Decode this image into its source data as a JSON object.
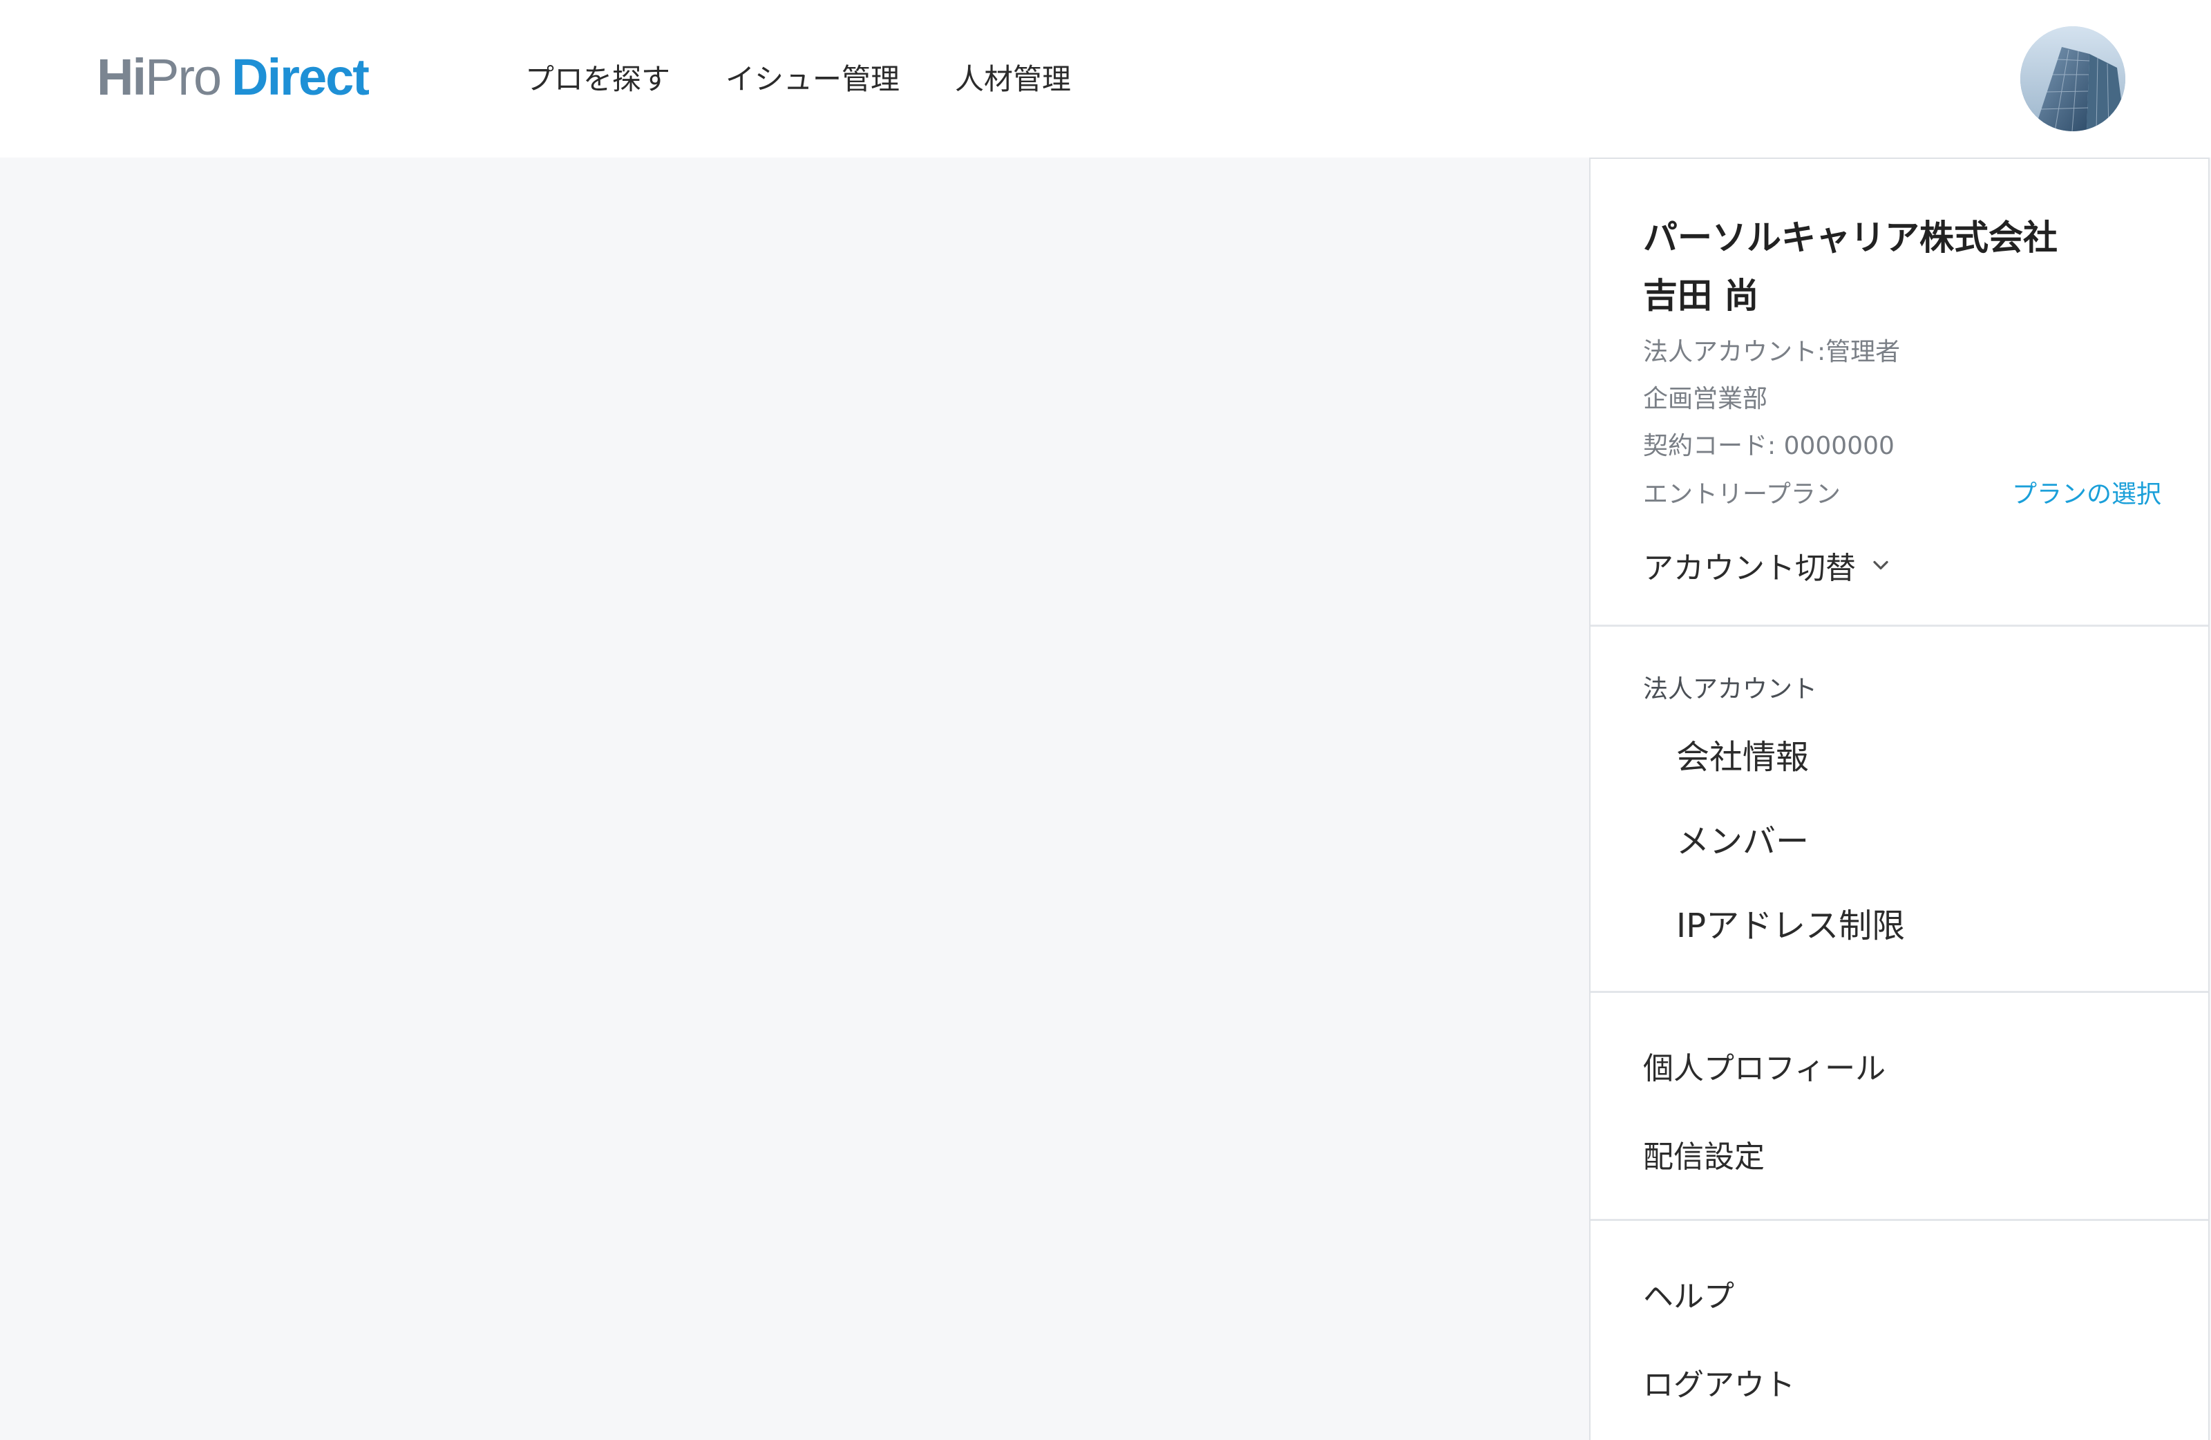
{
  "header": {
    "logo": {
      "part1": "Hi",
      "part2": "Pro",
      "part3": "Direct"
    },
    "nav": [
      {
        "label": "プロを探す"
      },
      {
        "label": "イシュー管理"
      },
      {
        "label": "人材管理"
      }
    ],
    "avatar_alt": "user-avatar"
  },
  "dropdown": {
    "company": "パーソルキャリア株式会社",
    "user_name": "吉田 尚",
    "account_type": "法人アカウント:管理者",
    "department": "企画営業部",
    "contract_code": "契約コード: 0000000",
    "plan": "エントリープラン",
    "plan_link": "プランの選択",
    "account_switch": "アカウント切替",
    "corporate_section": {
      "label": "法人アカウント",
      "items": [
        {
          "label": "会社情報"
        },
        {
          "label": "メンバー"
        },
        {
          "label": "IPアドレス制限"
        }
      ]
    },
    "personal_items": [
      {
        "label": "個人プロフィール"
      },
      {
        "label": "配信設定"
      }
    ],
    "misc_items": [
      {
        "label": "ヘルプ"
      },
      {
        "label": "ログアウト"
      }
    ]
  },
  "colors": {
    "accent": "#1a9fd9",
    "logo_gray": "#7b8591",
    "logo_blue": "#1e90d6",
    "background": "#f6f7f9",
    "divider": "#e3e6ea"
  }
}
